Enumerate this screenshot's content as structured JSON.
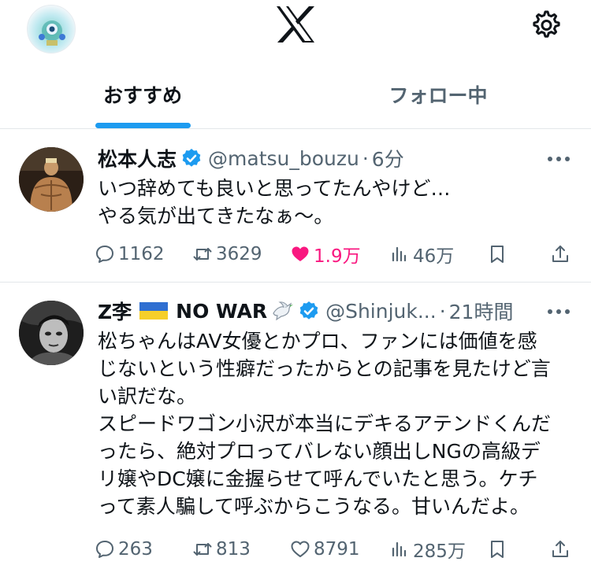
{
  "app": {
    "brand_icon": "x-logo",
    "settings_icon": "gear-icon"
  },
  "tabs": [
    {
      "label": "おすすめ",
      "selected": true
    },
    {
      "label": "フォロー中",
      "selected": false
    }
  ],
  "colors": {
    "accent": "#1d9bf0",
    "like_active": "#f91880",
    "muted": "#536471"
  },
  "tweets": [
    {
      "name": "松本人志",
      "handle": "@matsu_bouzu",
      "dot": "·",
      "time": "6分",
      "text": "いつ辞めても良いと思ってたんやけど…\nやる気が出てきたなぁ〜。",
      "reply_count": "1162",
      "repost_count": "3629",
      "like_count": "1.9万",
      "liked": true,
      "view_count": "46万"
    },
    {
      "name": "Z李",
      "name_suffix": "NO WAR",
      "handle": "@Shinjuk...",
      "dot": "·",
      "time": "21時間",
      "text": "松ちゃんはAV女優とかプロ、ファンには価値を感\nじないという性癖だったからとの記事を見たけど言\nい訳だな。\nスピードワゴン小沢が本当にデキるアテンドくんだ\nったら、絶対プロってバレない顔出しNGの高級デ\nリ嬢やDC嬢に金握らせて呼んでいたと思う。ケチ\nって素人騙して呼ぶからこうなる。甘いんだよ。",
      "reply_count": "263",
      "repost_count": "813",
      "like_count": "8791",
      "liked": false,
      "view_count": "285万"
    }
  ]
}
